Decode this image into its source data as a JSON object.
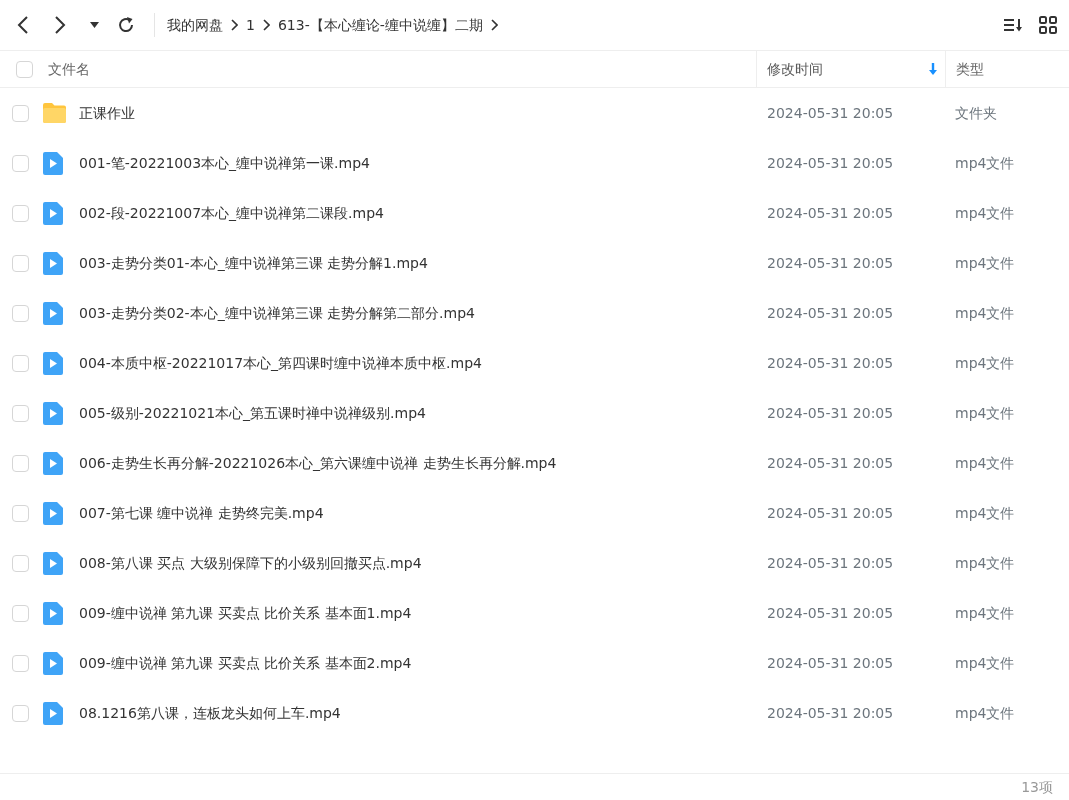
{
  "toolbar": {
    "breadcrumb": [
      "我的网盘",
      "1",
      "613-【本心缠论-缠中说缠】二期"
    ]
  },
  "table": {
    "select_all": {
      "checked": false
    },
    "columns": [
      {
        "label": "文件名",
        "sorted": false
      },
      {
        "label": "修改时间",
        "sorted": true
      },
      {
        "label": "类型",
        "sorted": false
      }
    ],
    "rows": [
      {
        "kind": "folder",
        "checked": false,
        "name": "正课作业",
        "modified": "2024-05-31 20:05",
        "type": "文件夹"
      },
      {
        "kind": "video",
        "checked": false,
        "name": "001-笔-20221003本心_缠中说禅第一课.mp4",
        "modified": "2024-05-31 20:05",
        "type": "mp4文件"
      },
      {
        "kind": "video",
        "checked": false,
        "name": "002-段-20221007本心_缠中说禅第二课段.mp4",
        "modified": "2024-05-31 20:05",
        "type": "mp4文件"
      },
      {
        "kind": "video",
        "checked": false,
        "name": "003-走势分类01-本心_缠中说禅第三课 走势分解1.mp4",
        "modified": "2024-05-31 20:05",
        "type": "mp4文件"
      },
      {
        "kind": "video",
        "checked": false,
        "name": "003-走势分类02-本心_缠中说禅第三课 走势分解第二部分.mp4",
        "modified": "2024-05-31 20:05",
        "type": "mp4文件"
      },
      {
        "kind": "video",
        "checked": false,
        "name": "004-本质中枢-20221017本心_第四课时缠中说禅本质中枢.mp4",
        "modified": "2024-05-31 20:05",
        "type": "mp4文件"
      },
      {
        "kind": "video",
        "checked": false,
        "name": "005-级别-20221021本心_第五课时禅中说禅级别.mp4",
        "modified": "2024-05-31 20:05",
        "type": "mp4文件"
      },
      {
        "kind": "video",
        "checked": false,
        "name": "006-走势生长再分解-20221026本心_第六课缠中说禅 走势生长再分解.mp4",
        "modified": "2024-05-31 20:05",
        "type": "mp4文件"
      },
      {
        "kind": "video",
        "checked": false,
        "name": "007-第七课 缠中说禅 走势终完美.mp4",
        "modified": "2024-05-31 20:05",
        "type": "mp4文件"
      },
      {
        "kind": "video",
        "checked": false,
        "name": "008-第八课 买点 大级别保障下的小级别回撤买点.mp4",
        "modified": "2024-05-31 20:05",
        "type": "mp4文件"
      },
      {
        "kind": "video",
        "checked": false,
        "name": "009-缠中说禅 第九课 买卖点 比价关系 基本面1.mp4",
        "modified": "2024-05-31 20:05",
        "type": "mp4文件"
      },
      {
        "kind": "video",
        "checked": false,
        "name": "009-缠中说禅 第九课 买卖点 比价关系 基本面2.mp4",
        "modified": "2024-05-31 20:05",
        "type": "mp4文件"
      },
      {
        "kind": "video",
        "checked": false,
        "name": "08.1216第八课，连板龙头如何上车.mp4",
        "modified": "2024-05-31 20:05",
        "type": "mp4文件"
      }
    ]
  },
  "status_bar": {
    "count": "13项"
  }
}
